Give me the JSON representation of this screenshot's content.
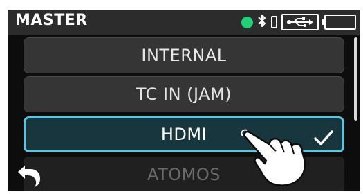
{
  "header": {
    "title": "MASTER",
    "bluetooth_glyph": "∗",
    "status_dot_color": "#22d07a"
  },
  "menu": {
    "items": [
      {
        "label": "INTERNAL",
        "selected": false
      },
      {
        "label": "TC IN (JAM)",
        "selected": false
      },
      {
        "label": "HDMI",
        "selected": true
      },
      {
        "label": "ATOMOS",
        "selected": false
      }
    ]
  },
  "colors": {
    "selected_border": "#5fc5df",
    "selected_bg": "#18363e",
    "item_bg": "#353535",
    "accent_green": "#22d07a"
  },
  "icons": {
    "back": "back-arrow-icon",
    "check": "checkmark-icon",
    "usb": "usb-icon",
    "battery": "battery-icon",
    "phone": "smartphone-icon",
    "bluetooth": "bluetooth-icon",
    "hand": "pointing-hand-icon"
  }
}
